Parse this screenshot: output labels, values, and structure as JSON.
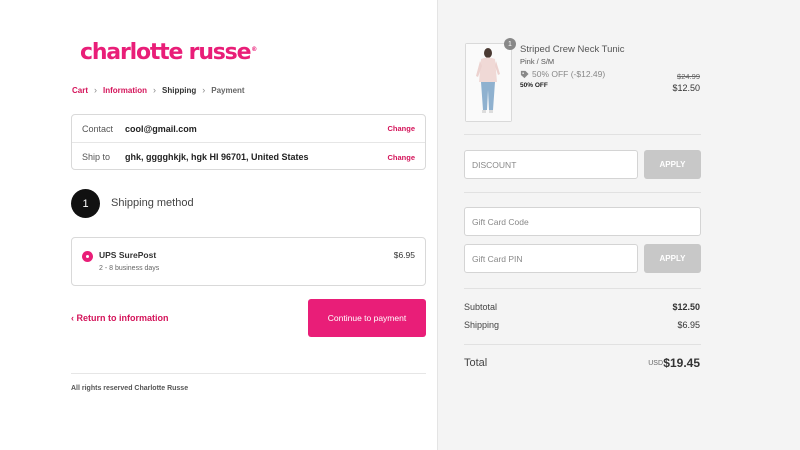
{
  "brand": {
    "logo_text": "charlotte russe",
    "logo_mark": "®",
    "accent": "#e91e78",
    "link": "#d4145a"
  },
  "breadcrumb": {
    "items": [
      "Cart",
      "Information",
      "Shipping",
      "Payment"
    ],
    "separator": "›"
  },
  "review": {
    "contact_label": "Contact",
    "contact_value": "cool@gmail.com",
    "ship_label": "Ship to",
    "ship_value": "ghk, gggghkjk, hgk HI 96701, United States",
    "change_label": "Change"
  },
  "step": {
    "number": "1",
    "title": "Shipping method"
  },
  "shipping_option": {
    "name": "UPS SurePost",
    "days": "2 - 8 business days",
    "price": "$6.95",
    "selected": true
  },
  "actions": {
    "return_label": "Return to information",
    "return_icon": "chevron-left-icon",
    "continue_label": "Continue to payment"
  },
  "footer": {
    "text": "All rights reserved Charlotte Russe"
  },
  "product": {
    "name": "Striped Crew Neck Tunic",
    "variant": "Pink / S/M",
    "quantity": "1",
    "discount_text": "50% OFF (-$12.49)",
    "discount_icon": "tag-icon",
    "off_label": "50% OFF",
    "original_price": "$24.99",
    "price": "$12.50"
  },
  "discount": {
    "placeholder": "DISCOUNT",
    "apply_label": "APPLY"
  },
  "gift_card": {
    "code_placeholder": "Gift Card Code",
    "pin_placeholder": "Gift Card PIN",
    "apply_label": "APPLY"
  },
  "summary": {
    "subtotal_label": "Subtotal",
    "subtotal_value": "$12.50",
    "shipping_label": "Shipping",
    "shipping_value": "$6.95",
    "total_label": "Total",
    "currency": "USD",
    "total_value": "$19.45"
  }
}
